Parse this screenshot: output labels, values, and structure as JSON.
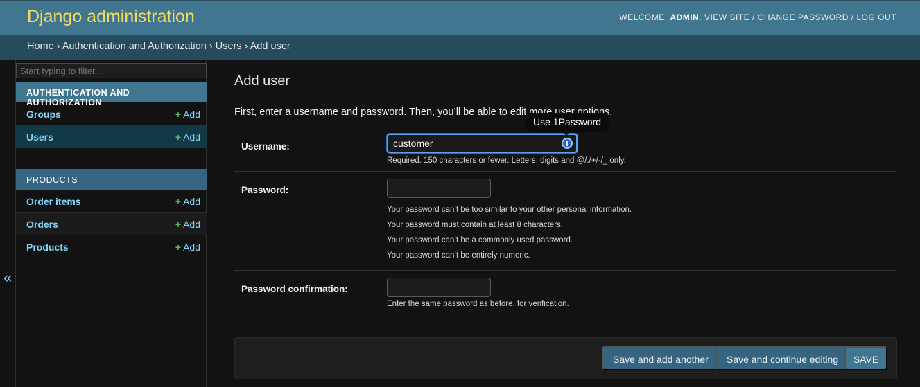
{
  "header": {
    "brand": "Django administration",
    "welcome": "WELCOME,",
    "username": "ADMIN",
    "view_site": "VIEW SITE",
    "change_password": "CHANGE PASSWORD",
    "log_out": "LOG OUT",
    "separator": "/"
  },
  "breadcrumbs": {
    "home": "Home",
    "app": "Authentication and Authorization",
    "model": "Users",
    "current": "Add user",
    "separator": "›"
  },
  "sidebar": {
    "filter_placeholder": "Start typing to filter...",
    "modules": [
      {
        "caption": "AUTHENTICATION AND AUTHORIZATION",
        "items": [
          {
            "label": "Groups",
            "add": "Add"
          },
          {
            "label": "Users",
            "add": "Add"
          }
        ]
      },
      {
        "caption": "PRODUCTS",
        "items": [
          {
            "label": "Order items",
            "add": "Add"
          },
          {
            "label": "Orders",
            "add": "Add"
          },
          {
            "label": "Products",
            "add": "Add"
          }
        ]
      }
    ],
    "toggle": "«"
  },
  "content": {
    "title": "Add user",
    "intro": "First, enter a username and password. Then, you’ll be able to edit more user options.",
    "fields": {
      "username": {
        "label": "Username:",
        "value": "customer",
        "help": "Required. 150 characters or fewer. Letters, digits and @/./+/-/_ only."
      },
      "password": {
        "label": "Password:",
        "value": "",
        "help": [
          "Your password can’t be too similar to your other personal information.",
          "Your password must contain at least 8 characters.",
          "Your password can’t be a commonly used password.",
          "Your password can’t be entirely numeric."
        ]
      },
      "password_confirmation": {
        "label": "Password confirmation:",
        "value": "",
        "help": "Enter the same password as before, for verification."
      }
    },
    "tooltip": "Use 1Password",
    "buttons": {
      "save_add_another": "Save and add another",
      "save_continue": "Save and continue editing",
      "save": "SAVE"
    }
  },
  "colors": {
    "header_bg": "#417690",
    "brand": "#f5dd5d",
    "breadcrumbs_bg": "#264b5d",
    "link": "#81d4fa",
    "add_plus": "#5fb65f",
    "focus_border": "#5fa0f5"
  },
  "icons": {
    "password_manager": "1password-icon",
    "add": "plus-icon",
    "toggle_sidebar": "double-chevron-left-icon"
  }
}
